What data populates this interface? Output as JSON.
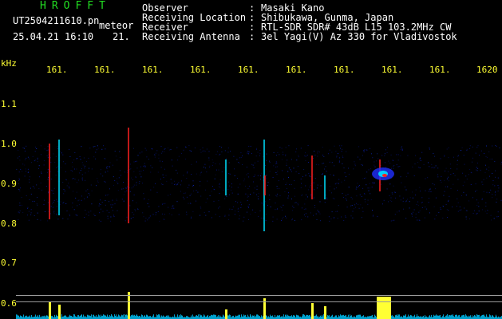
{
  "header": {
    "app_title": "HROFFT",
    "file_name": "UT2504211610.pn",
    "file_suffix": "meteor",
    "date_time": "25.04.21 16:10",
    "freq_partial": "21."
  },
  "info": {
    "observer_label": "Observer",
    "observer_value": "Masaki Kano",
    "location_label": "Receiving Location",
    "location_value": "Shibukawa, Gunma, Japan",
    "receiver_label": "Receiver",
    "receiver_value": "RTL-SDR SDR# 43dB L15 103.2MHz CW",
    "antenna_label": "Receiving Antenna",
    "antenna_value": "3el Yagi(V) Az 330 for Vladivostok",
    "separator": ":"
  },
  "axes": {
    "y_unit": "kHz",
    "y_ticks": [
      "1.1",
      "1.0",
      "0.9",
      "0.8",
      "0.7",
      "0.6"
    ],
    "x_ticks": [
      "161.",
      "161.",
      "161.",
      "161.",
      "161.",
      "161.",
      "161.",
      "161.",
      "161.",
      "1620"
    ]
  },
  "colors": {
    "background": "#000000",
    "header_green": "#22dd22",
    "label_white": "#ffffff",
    "tick_yellow": "#ffff33",
    "signal_red": "#ff2020",
    "signal_blue": "#2030ff",
    "signal_cyan": "#00e0ff",
    "noise_cyan": "#00c8ff",
    "guide_gray": "#9a9a9a"
  },
  "icons": {
    "waterfall": "spectrogram-waterfall",
    "level_meter": "signal-level-histogram"
  }
}
